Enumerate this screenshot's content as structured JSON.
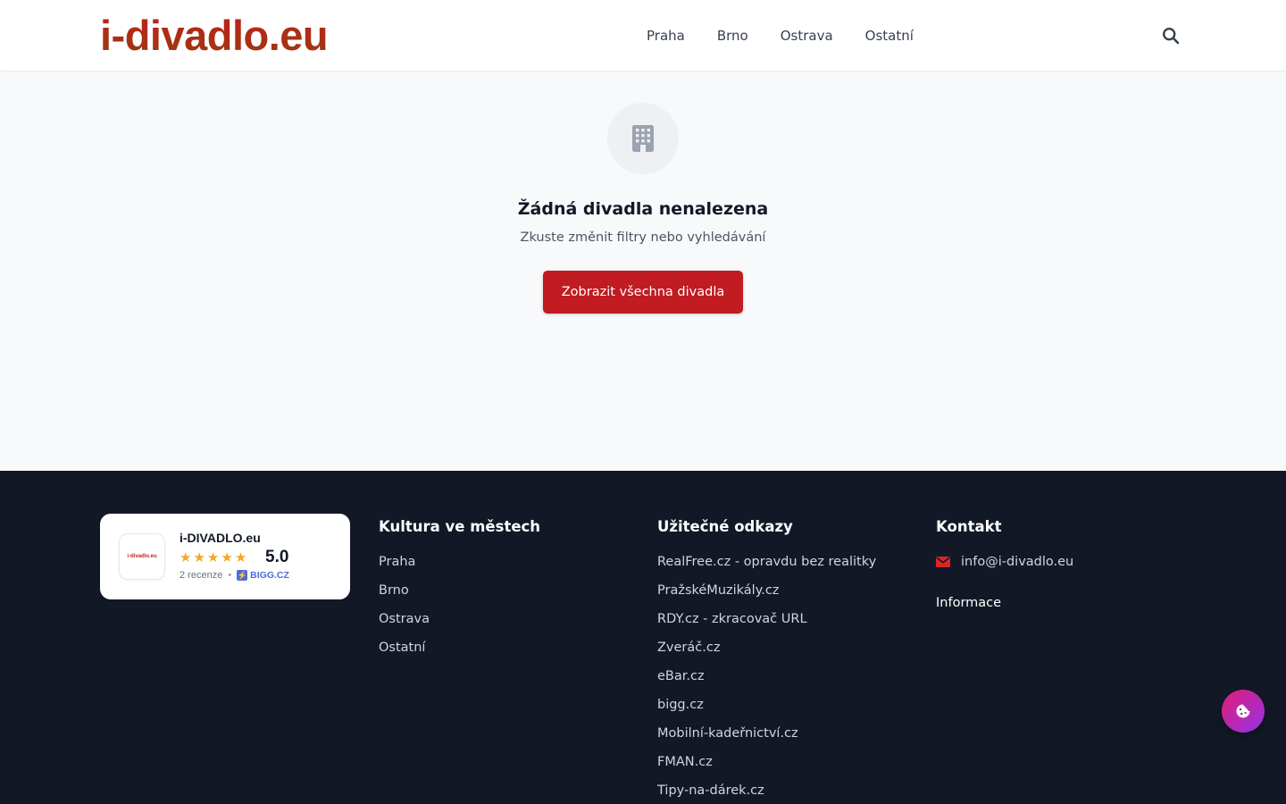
{
  "header": {
    "logo_text": "i-divadlo.eu",
    "nav": [
      "Praha",
      "Brno",
      "Ostrava",
      "Ostatní"
    ]
  },
  "empty_state": {
    "icon": "building-icon",
    "title": "Žádná divadla nenalezena",
    "subtitle": "Zkuste změnit filtry nebo vyhledávání",
    "button_label": "Zobrazit všechna divadla"
  },
  "footer": {
    "review": {
      "logo_text": "i-divadlo.eu",
      "name": "i-DIVADLO.eu",
      "stars": 5,
      "score": "5.0",
      "count": "2 recenze",
      "source": "BIGG.CZ"
    },
    "cities": {
      "title": "Kultura ve městech",
      "items": [
        "Praha",
        "Brno",
        "Ostrava",
        "Ostatní"
      ]
    },
    "links": {
      "title": "Užitečné odkazy",
      "items": [
        "RealFree.cz - opravdu bez realitky",
        "PražskéMuzikály.cz",
        "RDY.cz - zkracovač URL",
        "Zveráč.cz",
        "eBar.cz",
        "bigg.cz",
        "Mobilní-kadeřnictví.cz",
        "FMAN.cz",
        "Tipy-na-dárek.cz"
      ]
    },
    "contact": {
      "title": "Kontakt",
      "email": "info@i-divadlo.eu",
      "info_label": "Informace"
    }
  },
  "colors": {
    "brand_red": "#c01c22",
    "footer_bg": "#121826",
    "star": "#f5a623"
  }
}
